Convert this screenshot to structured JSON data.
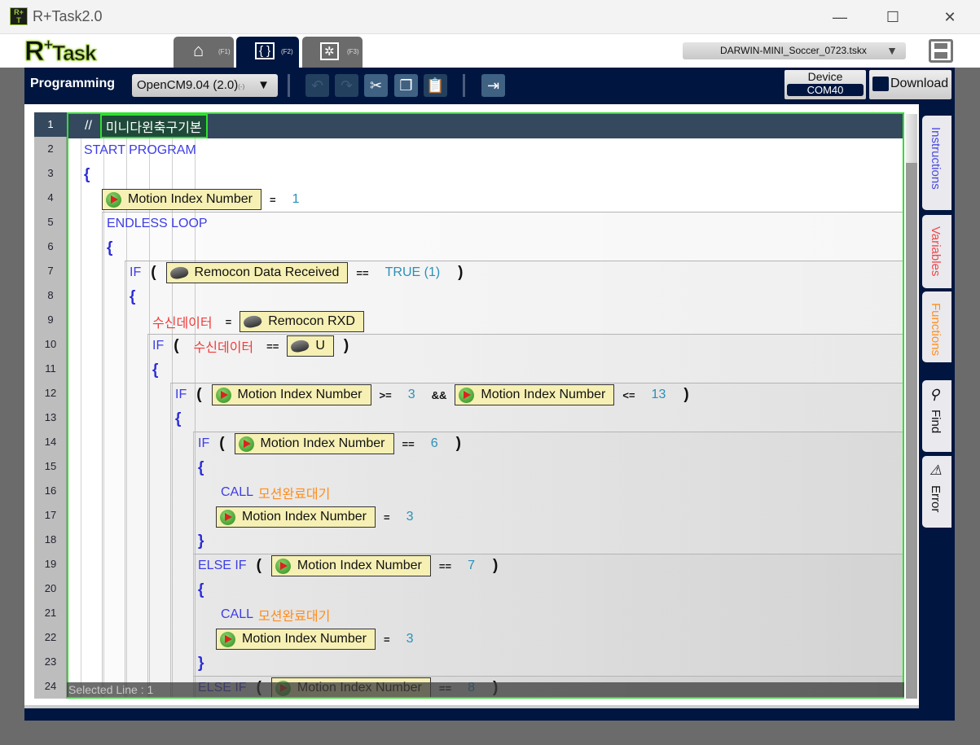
{
  "window": {
    "title": "R+Task2.0",
    "minimize": "—",
    "maximize": "☐",
    "close": "✕"
  },
  "header": {
    "logo": "R+Task",
    "tabs": [
      {
        "key": "(F1)",
        "icon": "home-icon"
      },
      {
        "key": "(F2)",
        "icon": "code-monitor-icon",
        "active": true
      },
      {
        "key": "(F3)",
        "icon": "robot-monitor-icon"
      }
    ],
    "file": "DARWIN-MINI_Soccer_0723.tskx"
  },
  "toolbar": {
    "mode": "Programming",
    "board": "OpenCM9.04 (2.0)",
    "board_suffix": "(-)",
    "device_label": "Device",
    "device_port": "COM40",
    "download": "Download"
  },
  "side_tabs": {
    "instructions": "Instructions",
    "variables": "Variables",
    "functions": "Functions",
    "find": "Find",
    "error": "Error"
  },
  "colors": {
    "instructions": "#4a4ae0",
    "variables": "#f04848",
    "functions": "#ff9020",
    "navy": "#001640",
    "selection_border": "#2ee02e"
  },
  "status": "Selected Line : 1",
  "lines": [
    {
      "n": 1,
      "level": 0,
      "sel": true,
      "tokens": [
        [
          "comment",
          "//"
        ],
        [
          "commentbox",
          "미니다윈축구기본"
        ]
      ]
    },
    {
      "n": 2,
      "level": 0,
      "tokens": [
        [
          "kw",
          "START PROGRAM"
        ]
      ]
    },
    {
      "n": 3,
      "level": 0,
      "tokens": [
        [
          "brace",
          "{"
        ]
      ]
    },
    {
      "n": 4,
      "level": 1,
      "tokens": [
        [
          "motion",
          "Motion Index Number"
        ],
        [
          "op",
          "="
        ],
        [
          "num",
          "1"
        ]
      ]
    },
    {
      "n": 5,
      "level": 1,
      "tokens": [
        [
          "kw",
          "ENDLESS LOOP"
        ]
      ]
    },
    {
      "n": 6,
      "level": 1,
      "tokens": [
        [
          "brace",
          "{"
        ]
      ]
    },
    {
      "n": 7,
      "level": 2,
      "tokens": [
        [
          "kw",
          "IF"
        ],
        [
          "paren",
          "("
        ],
        [
          "remocon",
          "Remocon Data Received"
        ],
        [
          "op",
          "=="
        ],
        [
          "num",
          "TRUE (1)"
        ],
        [
          "paren",
          ")"
        ]
      ]
    },
    {
      "n": 8,
      "level": 2,
      "tokens": [
        [
          "brace",
          "{"
        ]
      ]
    },
    {
      "n": 9,
      "level": 3,
      "tokens": [
        [
          "var",
          "수신데이터"
        ],
        [
          "op",
          "="
        ],
        [
          "remocon",
          "Remocon RXD"
        ]
      ]
    },
    {
      "n": 10,
      "level": 3,
      "tokens": [
        [
          "kw",
          "IF"
        ],
        [
          "paren",
          "("
        ],
        [
          "var",
          "수신데이터"
        ],
        [
          "op",
          "=="
        ],
        [
          "remocon",
          "U"
        ],
        [
          "paren",
          ")"
        ]
      ]
    },
    {
      "n": 11,
      "level": 3,
      "tokens": [
        [
          "brace",
          "{"
        ]
      ]
    },
    {
      "n": 12,
      "level": 4,
      "tokens": [
        [
          "kw",
          "IF"
        ],
        [
          "paren",
          "("
        ],
        [
          "motion",
          "Motion Index Number"
        ],
        [
          "op",
          ">="
        ],
        [
          "num",
          "3"
        ],
        [
          "op",
          "&&"
        ],
        [
          "motion",
          "Motion Index Number"
        ],
        [
          "op",
          "<="
        ],
        [
          "num",
          "13"
        ],
        [
          "paren",
          ")"
        ]
      ]
    },
    {
      "n": 13,
      "level": 4,
      "tokens": [
        [
          "brace",
          "{"
        ]
      ]
    },
    {
      "n": 14,
      "level": 5,
      "tokens": [
        [
          "kw",
          "IF"
        ],
        [
          "paren",
          "("
        ],
        [
          "motion",
          "Motion Index Number"
        ],
        [
          "op",
          "=="
        ],
        [
          "num",
          "6"
        ],
        [
          "paren",
          ")"
        ]
      ]
    },
    {
      "n": 15,
      "level": 5,
      "tokens": [
        [
          "brace",
          "{"
        ]
      ]
    },
    {
      "n": 16,
      "level": 6,
      "tokens": [
        [
          "kw",
          "CALL"
        ],
        [
          "func",
          "모션완료대기"
        ]
      ]
    },
    {
      "n": 17,
      "level": 6,
      "tokens": [
        [
          "motion",
          "Motion Index Number"
        ],
        [
          "op",
          "="
        ],
        [
          "num",
          "3"
        ]
      ]
    },
    {
      "n": 18,
      "level": 5,
      "tokens": [
        [
          "brace",
          "}"
        ]
      ]
    },
    {
      "n": 19,
      "level": 5,
      "tokens": [
        [
          "kw",
          "ELSE IF"
        ],
        [
          "paren",
          "("
        ],
        [
          "motion",
          "Motion Index Number"
        ],
        [
          "op",
          "=="
        ],
        [
          "num",
          "7"
        ],
        [
          "paren",
          ")"
        ]
      ]
    },
    {
      "n": 20,
      "level": 5,
      "tokens": [
        [
          "brace",
          "{"
        ]
      ]
    },
    {
      "n": 21,
      "level": 6,
      "tokens": [
        [
          "kw",
          "CALL"
        ],
        [
          "func",
          "모션완료대기"
        ]
      ]
    },
    {
      "n": 22,
      "level": 6,
      "tokens": [
        [
          "motion",
          "Motion Index Number"
        ],
        [
          "op",
          "="
        ],
        [
          "num",
          "3"
        ]
      ]
    },
    {
      "n": 23,
      "level": 5,
      "tokens": [
        [
          "brace",
          "}"
        ]
      ]
    },
    {
      "n": 24,
      "level": 5,
      "tokens": [
        [
          "kw",
          "ELSE IF"
        ],
        [
          "paren",
          "("
        ],
        [
          "motion",
          "Motion Index Number"
        ],
        [
          "op",
          "=="
        ],
        [
          "num",
          "8"
        ],
        [
          "paren",
          ")"
        ]
      ]
    }
  ]
}
